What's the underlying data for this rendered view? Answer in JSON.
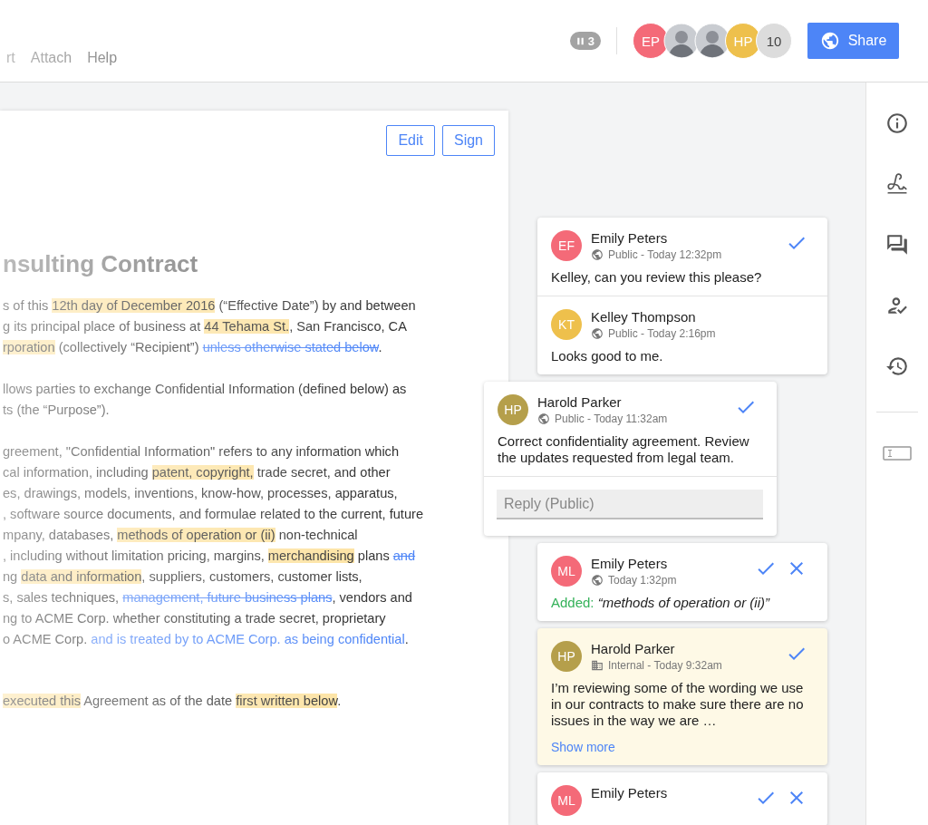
{
  "menu": [
    "rt",
    "Attach",
    "Help"
  ],
  "presence": {
    "paused_count": "3",
    "avatars": [
      {
        "kind": "initials",
        "initials": "EP",
        "color": "#f46a78"
      },
      {
        "kind": "photo"
      },
      {
        "kind": "photo"
      },
      {
        "kind": "initials",
        "initials": "HP",
        "color": "#eec04c"
      },
      {
        "kind": "count",
        "initials": "10",
        "color": "#dcdcdc"
      }
    ]
  },
  "share_button": "Share",
  "document": {
    "buttons": [
      "Edit",
      "Sign"
    ],
    "title": "nsulting Contract",
    "paragraphs": [
      [
        [
          {
            "kind": "plain",
            "text": "s of this "
          },
          {
            "kind": "highlight",
            "text": "12th day of December 2016"
          },
          {
            "kind": "plain",
            "text": " (“Effective Date”) by and between"
          }
        ],
        [
          {
            "kind": "plain",
            "text": "g its principal place of business at "
          },
          {
            "kind": "highlight",
            "text": "44 Tehama St."
          },
          {
            "kind": "plain",
            "text": ", San Francisco, CA"
          }
        ],
        [
          {
            "kind": "highlight",
            "text": "rporation"
          },
          {
            "kind": "plain",
            "text": " (collectively “Recipient”) "
          },
          {
            "kind": "delete",
            "text": "unless otherwise stated below"
          },
          {
            "kind": "plain",
            "text": "."
          }
        ]
      ],
      [
        [
          {
            "kind": "plain",
            "text": "llows parties to exchange Confidential Information (defined below) as"
          }
        ],
        [
          {
            "kind": "plain",
            "text": "ts (the “Purpose”)."
          }
        ]
      ],
      [
        [
          {
            "kind": "plain",
            "text": "greement, \"Confidential Information\" refers to any information which"
          }
        ],
        [
          {
            "kind": "plain",
            "text": "cal information, including "
          },
          {
            "kind": "highlight",
            "text": "patent, copyright,"
          },
          {
            "kind": "plain",
            "text": " trade secret, and other"
          }
        ],
        [
          {
            "kind": "plain",
            "text": "es, drawings, models, inventions, know-how, processes, apparatus,"
          }
        ],
        [
          {
            "kind": "plain",
            "text": ", software source documents, and formulae related to the current, future"
          }
        ],
        [
          {
            "kind": "plain",
            "text": "mpany, databases, "
          },
          {
            "kind": "highlight",
            "text": "methods of operation or (ii)"
          },
          {
            "kind": "plain",
            "text": " non-technical"
          }
        ],
        [
          {
            "kind": "plain",
            "text": ", including without limitation pricing, margins, "
          },
          {
            "kind": "highlight",
            "text": "merchandising"
          },
          {
            "kind": "plain",
            "text": " plans "
          },
          {
            "kind": "delete",
            "text": "and"
          }
        ],
        [
          {
            "kind": "plain",
            "text": "ng "
          },
          {
            "kind": "highlight",
            "text": "data and information"
          },
          {
            "kind": "plain",
            "text": ", suppliers, customers, customer lists,"
          }
        ],
        [
          {
            "kind": "plain",
            "text": "s, sales techniques, "
          },
          {
            "kind": "delete",
            "text": "management, future business plans"
          },
          {
            "kind": "plain",
            "text": ", vendors and"
          }
        ],
        [
          {
            "kind": "plain",
            "text": "ng to ACME Corp. whether constituting a trade secret, proprietary"
          }
        ],
        [
          {
            "kind": "plain",
            "text": "o ACME Corp. "
          },
          {
            "kind": "insert",
            "text": "and is treated by to ACME Corp. as being confidential"
          },
          {
            "kind": "plain",
            "text": "."
          }
        ]
      ]
    ],
    "closing": [
      {
        "kind": "highlight",
        "text": "executed this"
      },
      {
        "kind": "plain",
        "text": " Agreement as of the date "
      },
      {
        "kind": "highlight",
        "text": "first written below"
      },
      {
        "kind": "plain",
        "text": "."
      }
    ]
  },
  "comments": [
    {
      "selected": false,
      "highlighted": false,
      "entries": [
        {
          "initials": "EF",
          "color": "#f46a78",
          "author": "Emily Peters",
          "kind": "public",
          "meta": "Public - Today 12:32pm",
          "can_resolve": true,
          "can_reject": false,
          "body": "Kelley, can you review this please?"
        },
        {
          "initials": "KT",
          "color": "#eec04c",
          "author": "Kelley Thompson",
          "kind": "public",
          "meta": "Public - Today 2:16pm",
          "can_resolve": false,
          "can_reject": false,
          "body": "Looks good to me."
        }
      ]
    },
    {
      "selected": true,
      "highlighted": false,
      "entries": [
        {
          "initials": "HP",
          "color": "#b59f4b",
          "author": "Harold Parker",
          "kind": "public",
          "meta": "Public - Today 11:32am",
          "can_resolve": true,
          "can_reject": false,
          "body": "Correct confidentiality agreement. Review the updates requested from legal team."
        }
      ],
      "reply": {
        "placeholder": "Reply (Public)"
      }
    },
    {
      "selected": false,
      "highlighted": false,
      "entries": [
        {
          "initials": "ML",
          "color": "#f46a78",
          "author": "Emily Peters",
          "kind": "public",
          "meta": "Today 1:32pm",
          "can_resolve": true,
          "can_reject": true,
          "change": {
            "label": "Added:",
            "text": "“methods of operation or (ii)”"
          }
        }
      ]
    },
    {
      "selected": false,
      "highlighted": true,
      "entries": [
        {
          "initials": "HP",
          "color": "#b59f4b",
          "author": "Harold Parker",
          "kind": "internal",
          "meta": "Internal - Today 9:32am",
          "can_resolve": true,
          "can_reject": false,
          "body": "I’m reviewing some of the wording we use in our contracts to make sure there are no issues in the way we are …",
          "show_more": "Show more"
        }
      ]
    },
    {
      "selected": false,
      "highlighted": false,
      "entries": [
        {
          "initials": "ML",
          "color": "#f46a78",
          "author": "Emily Peters",
          "can_resolve": true,
          "can_reject": true
        }
      ]
    }
  ],
  "tools": [
    {
      "kind": "info"
    },
    {
      "kind": "signature"
    },
    {
      "kind": "comments"
    },
    {
      "kind": "approvals"
    },
    {
      "kind": "history"
    },
    {
      "kind": "divider"
    },
    {
      "kind": "field"
    }
  ]
}
